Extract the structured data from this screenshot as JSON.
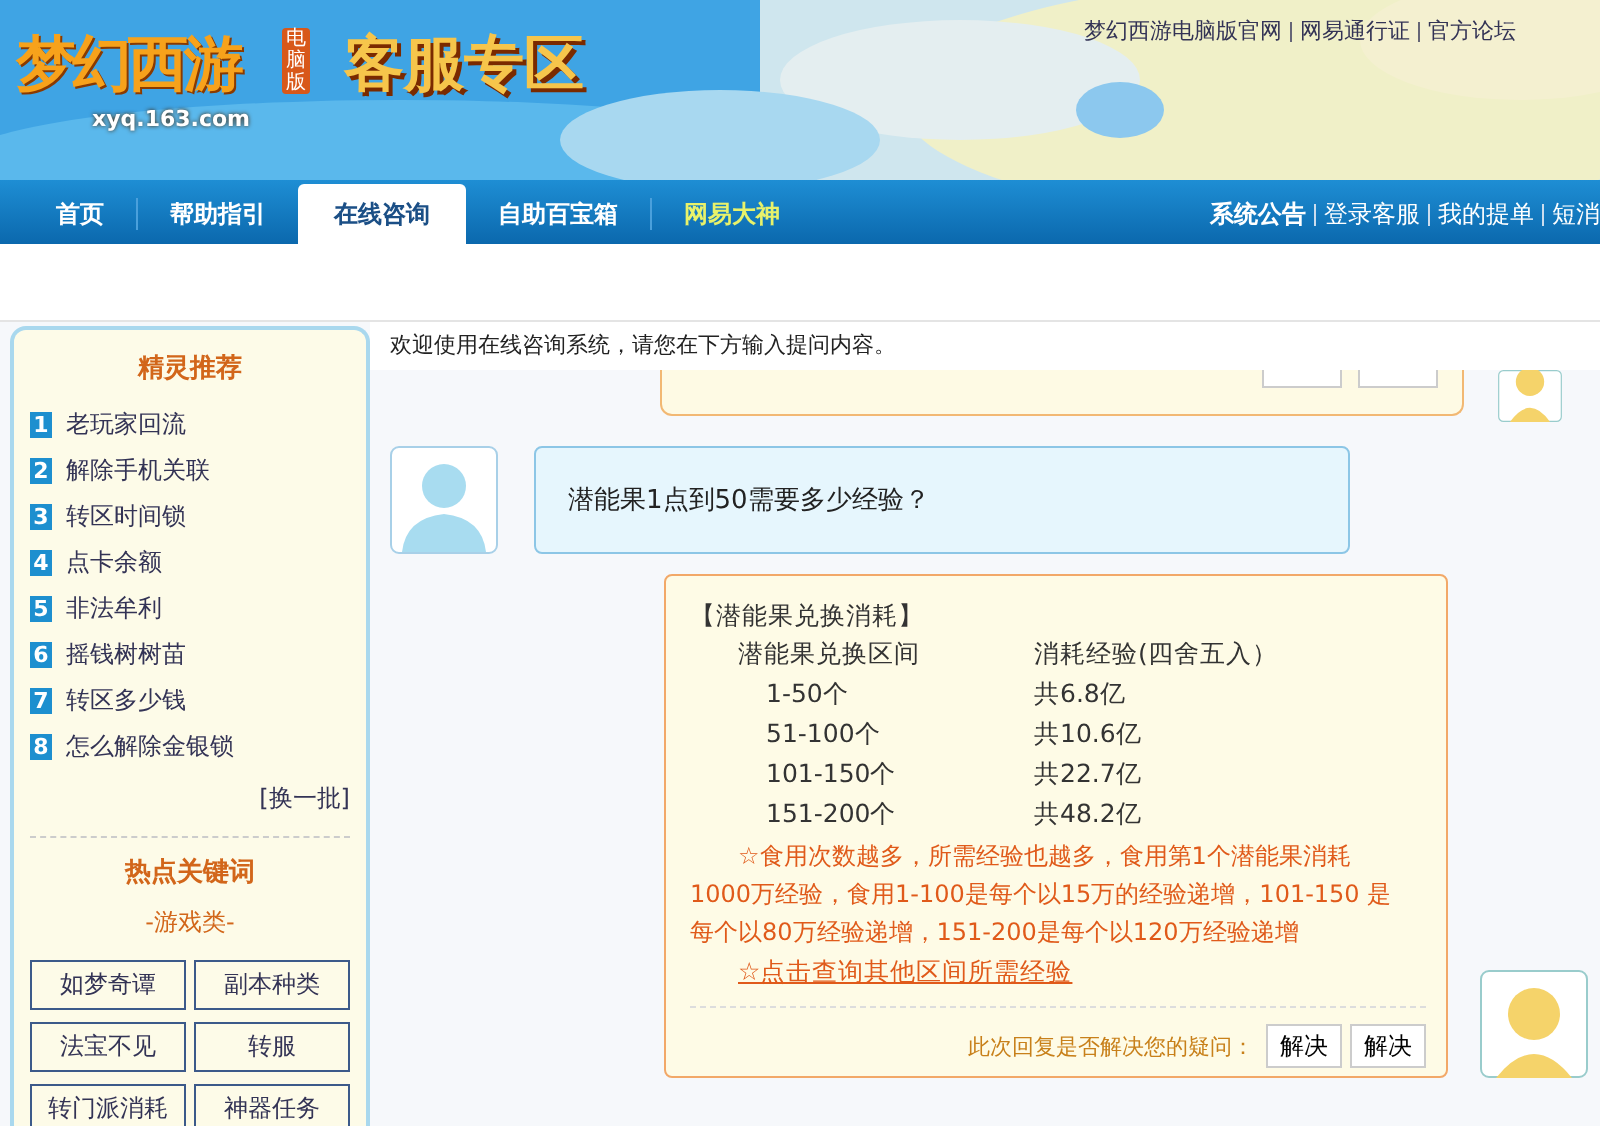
{
  "header": {
    "logo": {
      "name": "梦幻西游",
      "badge": "电脑版",
      "domain": "xyq.163.com"
    },
    "title": "客服专区",
    "links": [
      "梦幻西游电脑版官网",
      "网易通行证",
      "官方论坛"
    ]
  },
  "nav": {
    "tabs": [
      {
        "label": "首页",
        "selected": false,
        "highlight": false
      },
      {
        "label": "帮助指引",
        "selected": false,
        "highlight": false
      },
      {
        "label": "在线咨询",
        "selected": true,
        "highlight": false
      },
      {
        "label": "自助百宝箱",
        "selected": false,
        "highlight": false
      },
      {
        "label": "网易大神",
        "selected": false,
        "highlight": true
      }
    ],
    "links": [
      "系统公告",
      "登录客服",
      "我的提单",
      "短消"
    ]
  },
  "sidebar": {
    "recommend": {
      "title": "精灵推荐",
      "items": [
        {
          "num": "1",
          "label": "老玩家回流"
        },
        {
          "num": "2",
          "label": "解除手机关联"
        },
        {
          "num": "3",
          "label": "转区时间锁"
        },
        {
          "num": "4",
          "label": "点卡余额"
        },
        {
          "num": "5",
          "label": "非法牟利"
        },
        {
          "num": "6",
          "label": "摇钱树树苗"
        },
        {
          "num": "7",
          "label": "转区多少钱"
        },
        {
          "num": "8",
          "label": "怎么解除金银锁"
        }
      ],
      "refresh": "[换一批]"
    },
    "keywords": {
      "title": "热点关键词",
      "category": "-游戏类-",
      "items": [
        "如梦奇谭",
        "副本种类",
        "法宝不见",
        "转服",
        "转门派消耗",
        "神器任务"
      ]
    }
  },
  "chat": {
    "welcome": "欢迎使用在线咨询系统，请您在下方输入提问内容。",
    "messages": [
      {
        "kind": "user",
        "text": "潜能果1点到50需要多少经验？"
      },
      {
        "kind": "reply",
        "heading": "【潜能果兑换消耗】",
        "columns": [
          "潜能果兑换区间",
          "消耗经验(四舍五入）"
        ],
        "rows": [
          [
            "1-50个",
            "共6.8亿"
          ],
          [
            "51-100个",
            "共10.6亿"
          ],
          [
            "101-150个",
            "共22.7亿"
          ],
          [
            "151-200个",
            "共48.2亿"
          ]
        ],
        "note": "☆食用次数越多，所需经验也越多，食用第1个潜能果消耗1000万经验，食用1-100是每个以15万的经验递增，101-150 是每个以80万经验递增，151-200是每个以120万经验递增",
        "link": "☆点击查询其他区间所需经验",
        "feedback": "此次回复是否解决您的疑问：",
        "buttons": [
          "解决",
          "解决"
        ]
      }
    ]
  }
}
